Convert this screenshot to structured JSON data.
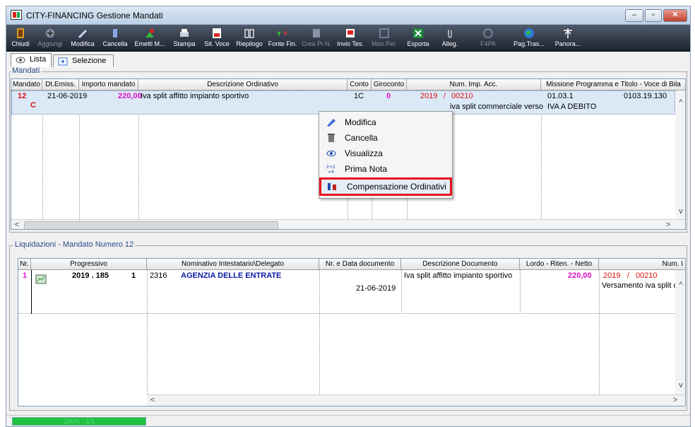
{
  "window": {
    "title": "CITY-FINANCING  Gestione Mandati",
    "controls": {
      "minimize": "–",
      "maximize": "▫",
      "close": "✕"
    }
  },
  "toolbar": {
    "buttons": [
      {
        "label": "Chiudi",
        "icon": "exit-door-icon",
        "enabled": true
      },
      {
        "label": "Aggiungi",
        "icon": "add-icon",
        "enabled": false
      },
      {
        "label": "Modifica",
        "icon": "edit-icon",
        "enabled": true
      },
      {
        "label": "Cancella",
        "icon": "delete-icon",
        "enabled": true
      },
      {
        "label": "Emetti M...",
        "icon": "emit-icon",
        "enabled": true
      },
      {
        "label": "Stampa",
        "icon": "print-icon",
        "enabled": true
      },
      {
        "label": "Sit. Voce",
        "icon": "situation-icon",
        "enabled": true
      },
      {
        "label": "Riepilogo",
        "icon": "summary-book-icon",
        "enabled": true
      },
      {
        "label": "Fonte Fin.",
        "icon": "funding-source-icon",
        "enabled": true
      },
      {
        "label": "Crea Pr.N.",
        "icon": "create-note-icon",
        "enabled": false
      },
      {
        "label": "Invio Tes.",
        "icon": "send-treasury-icon",
        "enabled": true
      },
      {
        "label": "Mon.Per.",
        "icon": "monitor-icon",
        "enabled": false
      },
      {
        "label": "Esporta",
        "icon": "excel-export-icon",
        "enabled": true
      },
      {
        "label": "Alleg.",
        "icon": "attachment-icon",
        "enabled": true
      },
      {
        "label": "F4PA",
        "icon": "f4pa-icon",
        "enabled": false
      },
      {
        "label": "Pag.Tras...",
        "icon": "globe-icon",
        "enabled": true
      },
      {
        "label": "Panora...",
        "icon": "panorama-icon",
        "enabled": true
      }
    ]
  },
  "tabs": [
    {
      "label": "Lista",
      "active": true
    },
    {
      "label": "Selezione",
      "active": false
    }
  ],
  "mandati": {
    "group_label": "Mandati",
    "columns": [
      "Mandato",
      "Dt.Emiss.",
      "Importo mandato",
      "Descrizione Ordinativo",
      "Conto",
      "Giroconto",
      "Num. Imp. Acc.",
      "Missione Programma e Titolo - Voce di Bila"
    ],
    "row": {
      "mandato": "12",
      "mandato_flag": "C",
      "dt_emiss": "21-06-2019",
      "importo": "220,00",
      "descrizione": "Iva split affitto impianto sportivo",
      "conto": "1C",
      "giroconto": "0",
      "num_year": "2019",
      "num_sep": "/",
      "num_code": "00210",
      "num_desc": "iva split commerciale verso",
      "missione_code": "01.03.1",
      "missione_voce": "0103.19.130",
      "missione_desc": "IVA A DEBITO"
    }
  },
  "context_menu": {
    "items": [
      {
        "label": "Modifica",
        "icon": "edit-icon"
      },
      {
        "label": "Cancella",
        "icon": "trash-icon"
      },
      {
        "label": "Visualizza",
        "icon": "eye-icon"
      },
      {
        "label": "Prima Nota",
        "icon": "calc-icon"
      },
      {
        "label": "Compensazione Ordinativi",
        "icon": "compensation-icon",
        "highlighted": true
      }
    ]
  },
  "liquidazioni": {
    "group_label": "Liquidazioni - Mandato Numero 12",
    "columns": [
      "Nr.",
      "Progressivo",
      "Nominativo Intestatario\\Delegato",
      "Nr. e Data documento",
      "Descrizione Documento",
      "Lordo - Riten. - Netto",
      "Num. I"
    ],
    "row": {
      "nr": "1",
      "progressivo": "2019 . 185",
      "progressivo_sub": "1",
      "codice": "2316",
      "nominativo": "AGENZIA DELLE ENTRATE",
      "data_doc": "21-06-2019",
      "descrizione": "Iva split affitto impianto sportivo",
      "lordo": "220,00",
      "num_year": "2019",
      "num_sep": "/",
      "num_code": "00210",
      "num_desc": "Versamento iva split comr"
    }
  },
  "status": {
    "progress_text": "100% - 1/1",
    "progress_fraction": 1.0
  },
  "colors": {
    "highlight_border": "#e8141c",
    "amount": "#e011c8",
    "name": "#0a1aa6",
    "year": "#d11111",
    "progress": "#20c040"
  }
}
